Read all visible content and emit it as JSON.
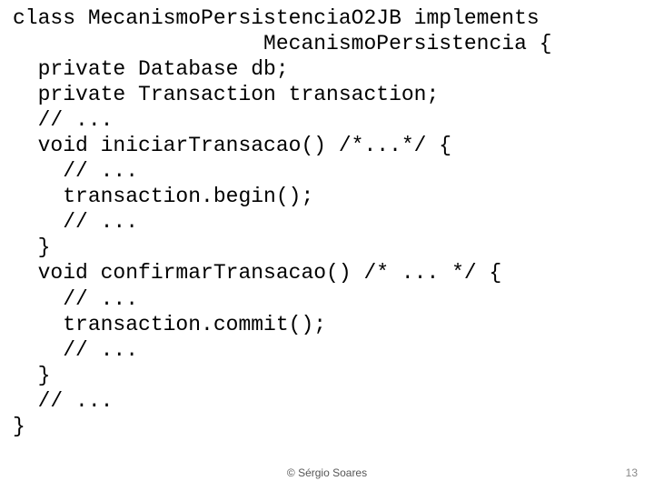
{
  "code": {
    "l01": "class MecanismoPersistenciaO2JB implements",
    "l02": "                    MecanismoPersistencia {",
    "l03": "  private Database db;",
    "l04": "  private Transaction transaction;",
    "l05": "  // ...",
    "l06": "  void iniciarTransacao() /*...*/ {",
    "l07": "    // ...",
    "l08": "    transaction.begin();",
    "l09": "    // ...",
    "l10": "  }",
    "l11": "  void confirmarTransacao() /* ... */ {",
    "l12": "    // ...",
    "l13": "    transaction.commit();",
    "l14": "    // ...",
    "l15": "  }",
    "l16": "  // ...",
    "l17": "}"
  },
  "footer": {
    "copyright": "© Sérgio Soares",
    "page": "13"
  }
}
